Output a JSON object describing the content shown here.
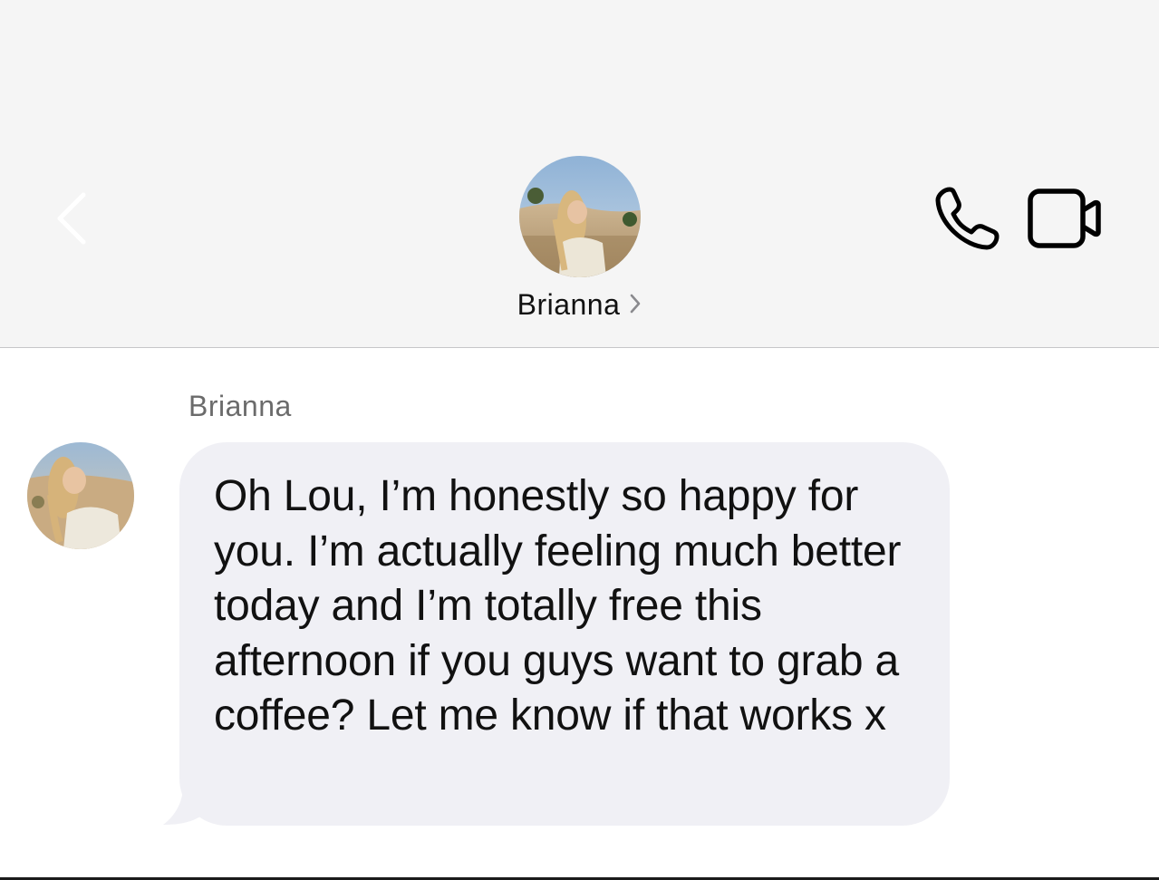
{
  "header": {
    "contact_name": "Brianna",
    "back_icon": "chevron-left-icon",
    "disclosure_icon": "chevron-right-icon",
    "call_icon": "phone-icon",
    "video_icon": "video-camera-icon",
    "avatar": "contact-photo"
  },
  "conversation": {
    "messages": [
      {
        "sender": "Brianna",
        "text": "Oh Lou, I’m honestly so happy for you. I’m actually feeling much better today and I’m totally free this afternoon if you guys want to grab a coffee? Let me know if that works x",
        "direction": "incoming"
      }
    ]
  },
  "colors": {
    "header_bg": "#f5f5f5",
    "incoming_bubble": "#f0f0f5",
    "back_chevron": "#ffffff",
    "text": "#111111",
    "sender_label": "#6b6b6b"
  }
}
